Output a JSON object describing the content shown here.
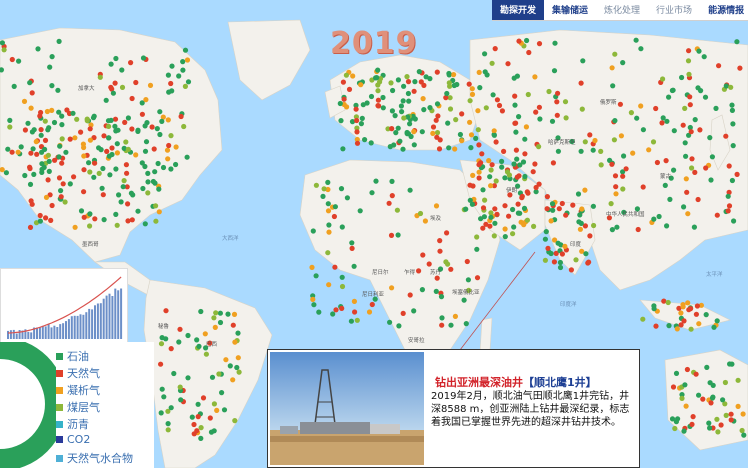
{
  "nav": {
    "tabs": [
      {
        "label": "勘探开发"
      },
      {
        "label": "集输储运"
      },
      {
        "label": "炼化处理"
      },
      {
        "label": "行业市场"
      },
      {
        "label": "能源情报"
      }
    ]
  },
  "year_label": "2019",
  "map_labels": {
    "canada": "加拿大",
    "atlantic": "大西洋",
    "mexico": "墨西哥",
    "brazil": "巴西",
    "mongolia": "蒙古",
    "china": "中华人民共和国",
    "ethiopia": "埃塞俄比亚",
    "niger": "尼日尔",
    "chad": "乍得",
    "sudan": "苏丹",
    "nigeria": "尼日利亚",
    "egypt": "埃及",
    "iran": "伊朗",
    "angola": "安哥拉",
    "peru": "秘鲁",
    "kazakhstan": "哈萨克斯坦",
    "russia": "俄罗斯",
    "india": "印度",
    "indian_ocean": "印度洋",
    "pacific": "太平洋"
  },
  "colors": {
    "oil": "#2aa05a",
    "gas": "#e0402a",
    "condensate": "#f0a020",
    "cbm": "#8db83a",
    "bitumen": "#35b2c8",
    "co2": "#2a3a9a",
    "hydrate": "#4fb0d6",
    "land": "#f3f1ec",
    "water": "#aadaff"
  },
  "legend": [
    {
      "label": "石油",
      "color_key": "oil"
    },
    {
      "label": "天然气",
      "color_key": "gas"
    },
    {
      "label": "凝析气",
      "color_key": "condensate"
    },
    {
      "label": "煤层气",
      "color_key": "cbm"
    },
    {
      "label": "沥青",
      "color_key": "bitumen"
    },
    {
      "label": "CO2",
      "color_key": "co2"
    },
    {
      "label": "天然气水合物",
      "color_key": "hydrate"
    }
  ],
  "news": {
    "title_main": "钻出亚洲最深油井",
    "title_highlight": "【顺北鹰1井】",
    "body": "2019年2月，顺北油气田顺北鹰1井完钻，井深8588 m，创亚洲陆上钻井最深纪录，标志着我国已掌握世界先进的超深井钻井技术。"
  }
}
